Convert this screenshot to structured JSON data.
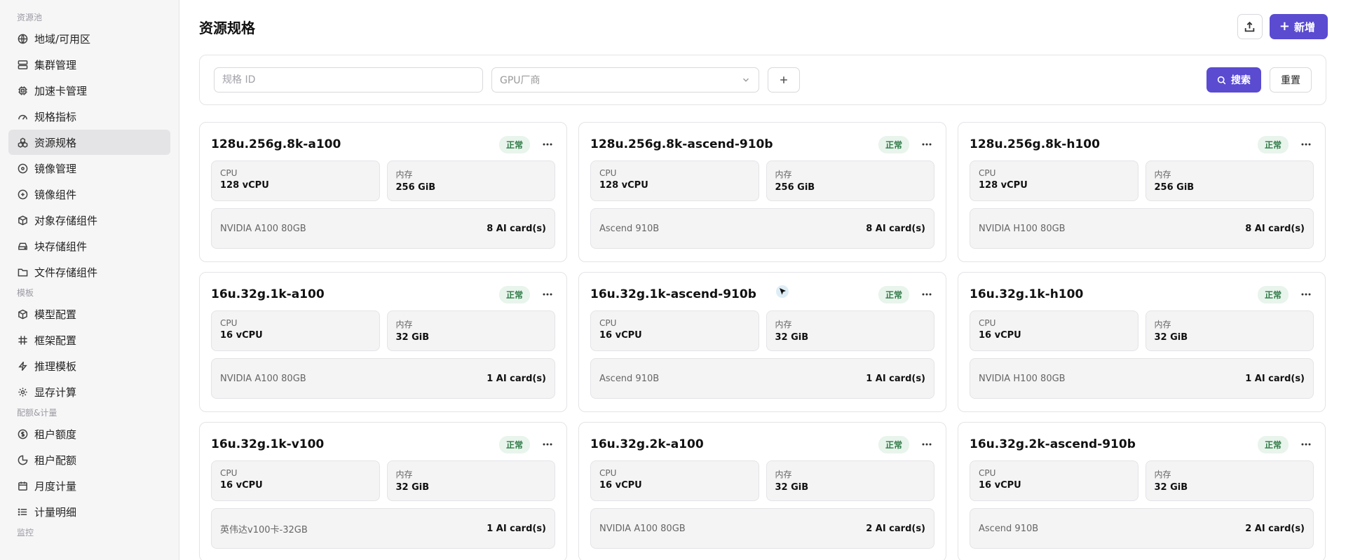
{
  "sidebar": {
    "groups": [
      {
        "title": "资源池",
        "items": [
          {
            "label": "地域/可用区",
            "icon": "globe-icon"
          },
          {
            "label": "集群管理",
            "icon": "server-icon"
          },
          {
            "label": "加速卡管理",
            "icon": "chip-icon"
          },
          {
            "label": "规格指标",
            "icon": "gauge-icon"
          },
          {
            "label": "资源规格",
            "icon": "cubes-icon",
            "active": true
          },
          {
            "label": "镜像管理",
            "icon": "disc-icon"
          },
          {
            "label": "镜像组件",
            "icon": "disc-plus-icon"
          },
          {
            "label": "对象存储组件",
            "icon": "box-icon"
          },
          {
            "label": "块存储组件",
            "icon": "drive-icon"
          },
          {
            "label": "文件存储组件",
            "icon": "folder-icon"
          }
        ]
      },
      {
        "title": "模板",
        "items": [
          {
            "label": "模型配置",
            "icon": "cube-icon"
          },
          {
            "label": "框架配置",
            "icon": "hash-icon"
          },
          {
            "label": "推理模板",
            "icon": "bolt-icon"
          },
          {
            "label": "显存计算",
            "icon": "gear-icon"
          }
        ]
      },
      {
        "title": "配额&计量",
        "items": [
          {
            "label": "租户额度",
            "icon": "dollar-circle-icon"
          },
          {
            "label": "租户配额",
            "icon": "pie-icon"
          },
          {
            "label": "月度计量",
            "icon": "calendar-icon"
          },
          {
            "label": "计量明细",
            "icon": "list-icon"
          }
        ]
      },
      {
        "title": "监控",
        "items": []
      }
    ]
  },
  "header": {
    "title": "资源规格",
    "export_icon": "export-icon",
    "new_label": "新增"
  },
  "filter": {
    "id_placeholder": "规格 ID",
    "gpu_placeholder": "GPU厂商",
    "search_label": "搜索",
    "reset_label": "重置"
  },
  "colors": {
    "accent": "#5a4bd1",
    "status_bg": "#e8f4ec",
    "status_text": "#2f7a46"
  },
  "cards": [
    {
      "name": "128u.256g.8k-a100",
      "status": "正常",
      "cpu_label": "CPU",
      "cpu": "128 vCPU",
      "mem_label": "内存",
      "mem": "256 GiB",
      "gpu": "NVIDIA A100 80GB",
      "cards": "8 AI card(s)"
    },
    {
      "name": "128u.256g.8k-ascend-910b",
      "status": "正常",
      "cpu_label": "CPU",
      "cpu": "128 vCPU",
      "mem_label": "内存",
      "mem": "256 GiB",
      "gpu": "Ascend 910B",
      "cards": "8 AI card(s)"
    },
    {
      "name": "128u.256g.8k-h100",
      "status": "正常",
      "cpu_label": "CPU",
      "cpu": "128 vCPU",
      "mem_label": "内存",
      "mem": "256 GiB",
      "gpu": "NVIDIA H100 80GB",
      "cards": "8 AI card(s)"
    },
    {
      "name": "16u.32g.1k-a100",
      "status": "正常",
      "cpu_label": "CPU",
      "cpu": "16 vCPU",
      "mem_label": "内存",
      "mem": "32 GiB",
      "gpu": "NVIDIA A100 80GB",
      "cards": "1 AI card(s)"
    },
    {
      "name": "16u.32g.1k-ascend-910b",
      "status": "正常",
      "cpu_label": "CPU",
      "cpu": "16 vCPU",
      "mem_label": "内存",
      "mem": "32 GiB",
      "gpu": "Ascend 910B",
      "cards": "1 AI card(s)"
    },
    {
      "name": "16u.32g.1k-h100",
      "status": "正常",
      "cpu_label": "CPU",
      "cpu": "16 vCPU",
      "mem_label": "内存",
      "mem": "32 GiB",
      "gpu": "NVIDIA H100 80GB",
      "cards": "1 AI card(s)"
    },
    {
      "name": "16u.32g.1k-v100",
      "status": "正常",
      "cpu_label": "CPU",
      "cpu": "16 vCPU",
      "mem_label": "内存",
      "mem": "32 GiB",
      "gpu": "英伟达v100卡-32GB",
      "cards": "1 AI card(s)"
    },
    {
      "name": "16u.32g.2k-a100",
      "status": "正常",
      "cpu_label": "CPU",
      "cpu": "16 vCPU",
      "mem_label": "内存",
      "mem": "32 GiB",
      "gpu": "NVIDIA A100 80GB",
      "cards": "2 AI card(s)"
    },
    {
      "name": "16u.32g.2k-ascend-910b",
      "status": "正常",
      "cpu_label": "CPU",
      "cpu": "16 vCPU",
      "mem_label": "内存",
      "mem": "32 GiB",
      "gpu": "Ascend 910B",
      "cards": "2 AI card(s)"
    }
  ]
}
